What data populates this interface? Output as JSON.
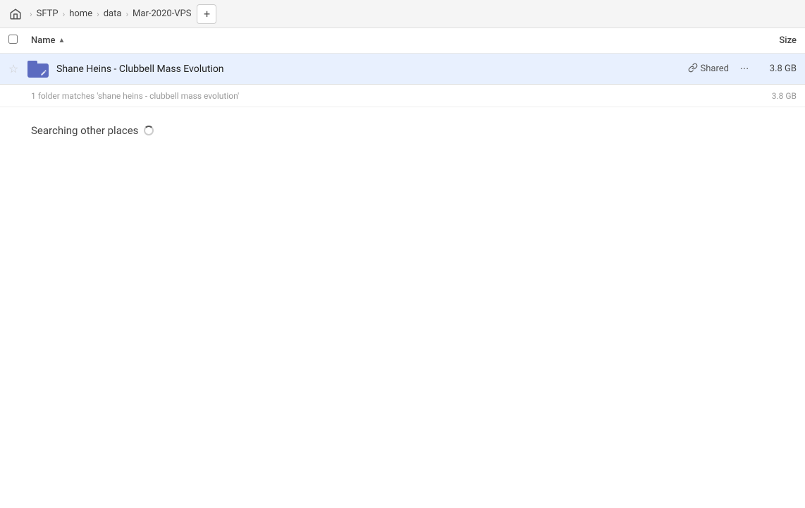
{
  "breadcrumb": {
    "home_label": "home",
    "items": [
      {
        "id": "sftp",
        "label": "SFTP"
      },
      {
        "id": "home",
        "label": "home"
      },
      {
        "id": "data",
        "label": "data"
      },
      {
        "id": "mar2020vps",
        "label": "Mar-2020-VPS"
      }
    ],
    "add_button_label": "+"
  },
  "column_headers": {
    "name_label": "Name",
    "sort_indicator": "▲",
    "size_label": "Size"
  },
  "file_row": {
    "name": "Shane Heins - Clubbell Mass Evolution",
    "shared_label": "Shared",
    "size": "3.8 GB",
    "star_char": "★",
    "more_char": "···"
  },
  "match_summary": {
    "text": "1 folder matches 'shane heins - clubbell mass evolution'",
    "size": "3.8 GB"
  },
  "searching_section": {
    "label": "Searching other places"
  },
  "icons": {
    "link": "🔗",
    "more": "···",
    "home": "⌂",
    "sort_asc": "▲"
  }
}
